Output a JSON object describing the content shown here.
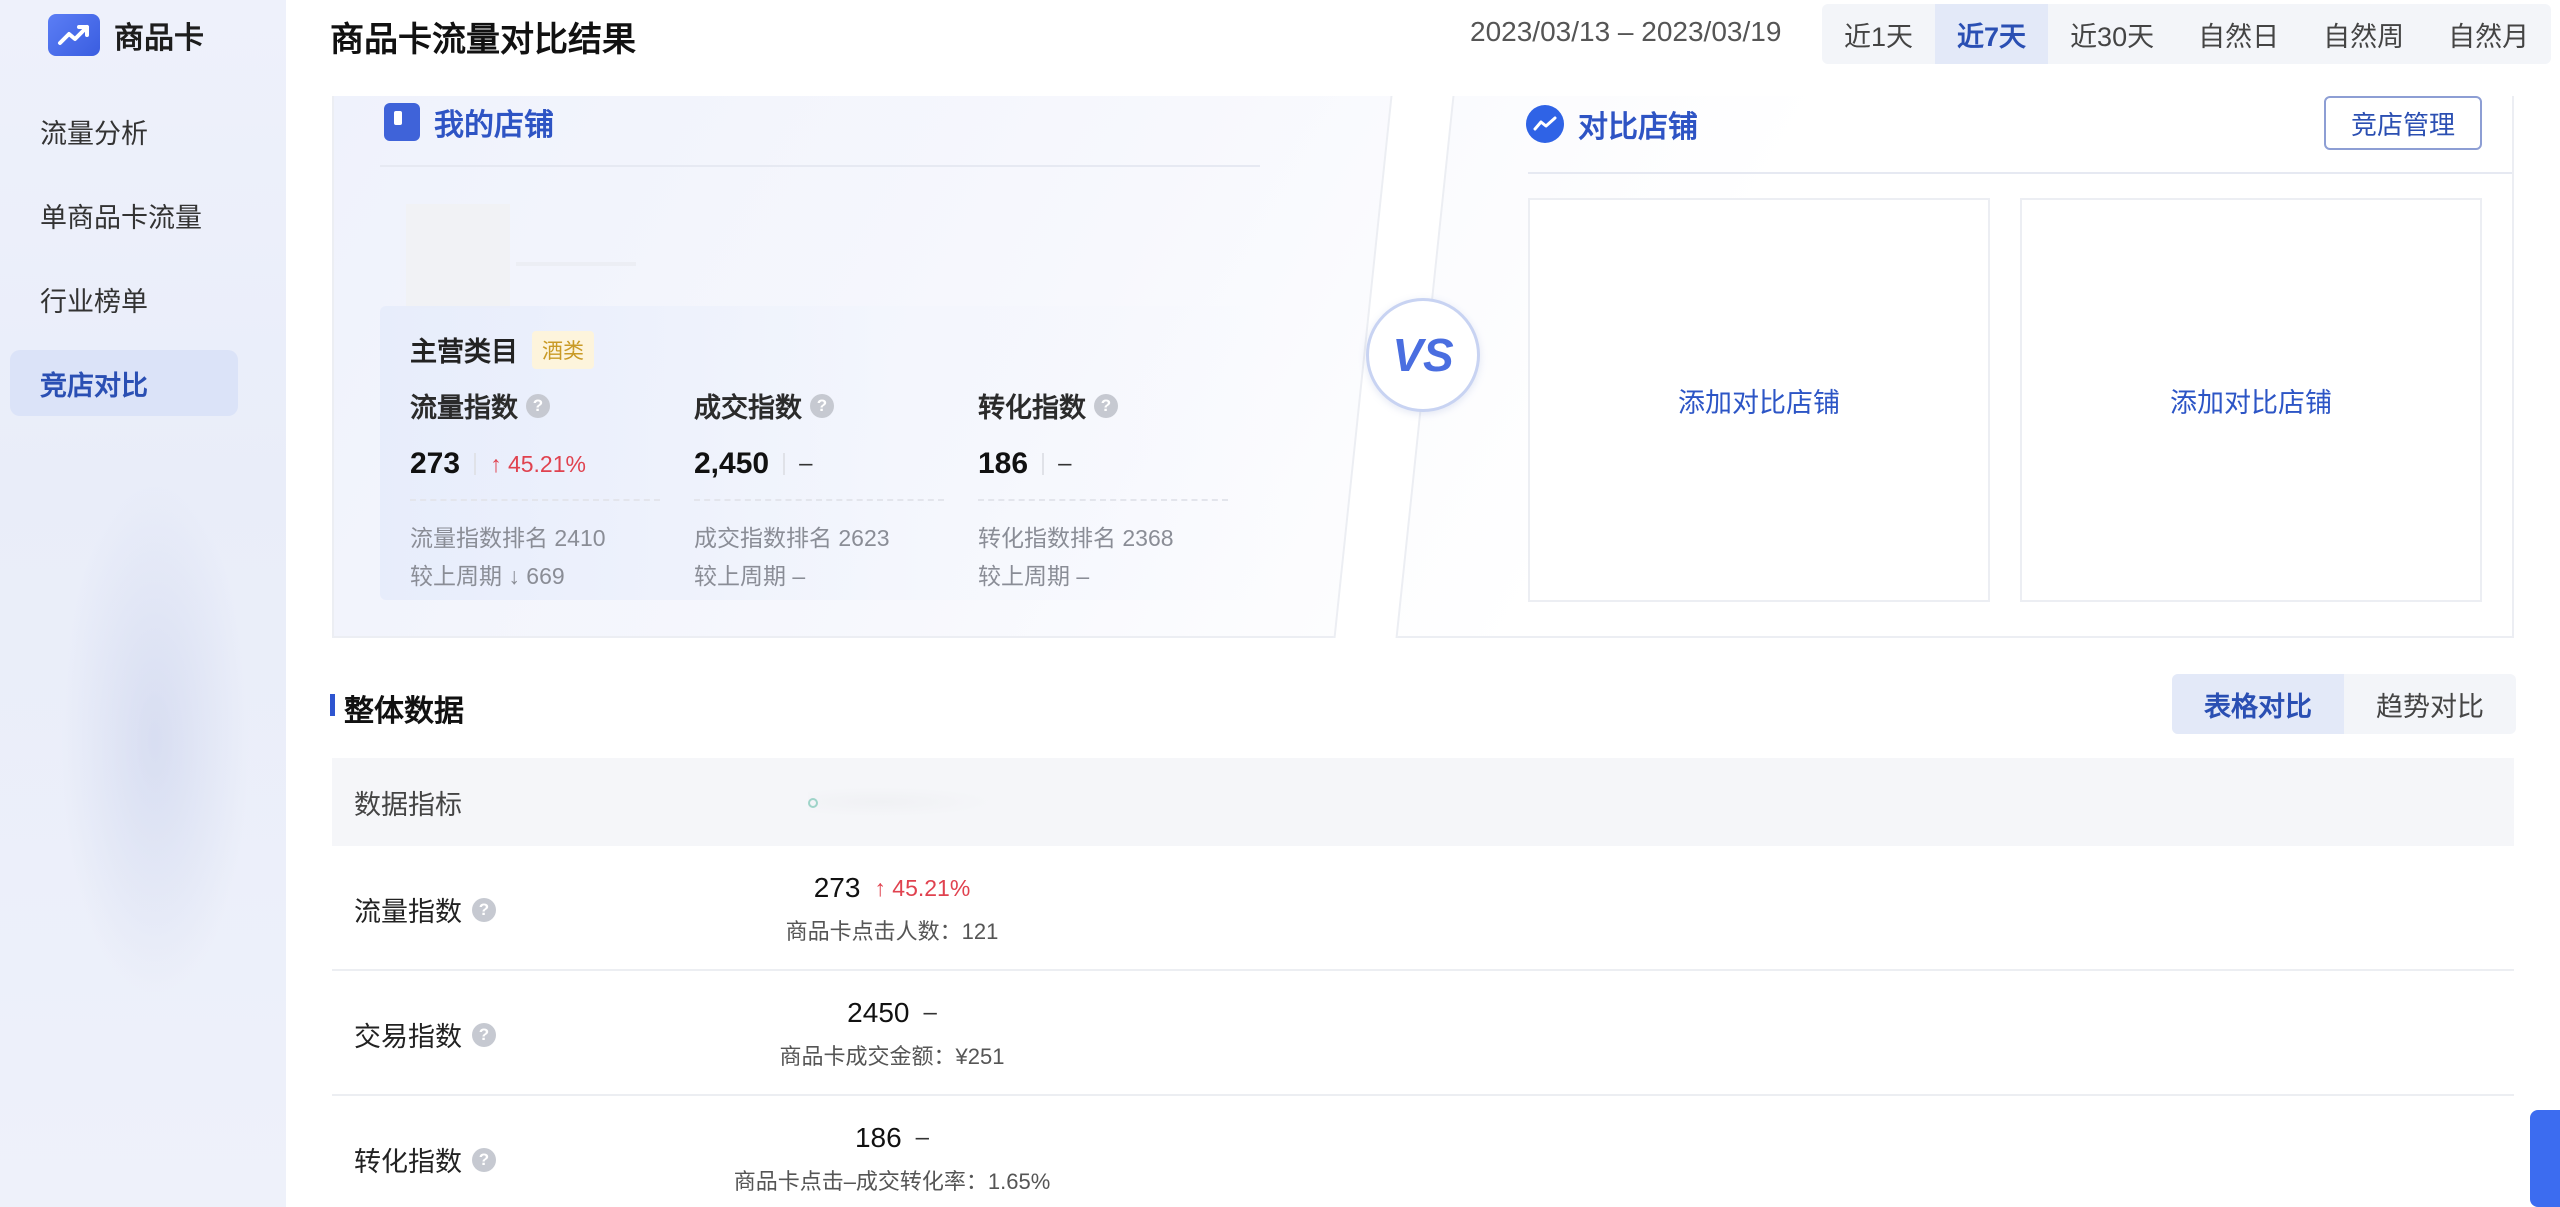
{
  "sidebar": {
    "brand": "商品卡",
    "items": [
      {
        "label": "流量分析"
      },
      {
        "label": "单商品卡流量"
      },
      {
        "label": "行业榜单"
      },
      {
        "label": "竞店对比",
        "active": true
      }
    ]
  },
  "header": {
    "title": "商品卡流量对比结果",
    "date_range": "2023/03/13 – 2023/03/19",
    "range_tabs": [
      "近1天",
      "近7天",
      "近30天",
      "自然日",
      "自然周",
      "自然月"
    ],
    "active_range": "近7天"
  },
  "my_shop": {
    "title": "我的店铺",
    "category_label": "主营类目",
    "category_tag": "酒类",
    "metrics": [
      {
        "name": "流量指数",
        "value": "273",
        "delta": "↑ 45.21%",
        "rank_label": "流量指数排名 2410",
        "period": "较上周期 ↓ 669"
      },
      {
        "name": "成交指数",
        "value": "2,450",
        "delta": "–",
        "rank_label": "成交指数排名 2623",
        "period": "较上周期 –"
      },
      {
        "name": "转化指数",
        "value": "186",
        "delta": "–",
        "rank_label": "转化指数排名 2368",
        "period": "较上周期 –"
      }
    ]
  },
  "vs_label": "VS",
  "compare": {
    "title": "对比店铺",
    "manage_button": "竞店管理",
    "add_slots": [
      "添加对比店铺",
      "添加对比店铺"
    ]
  },
  "overall": {
    "title": "整体数据",
    "view_tabs": [
      "表格对比",
      "趋势对比"
    ],
    "active_view": "表格对比",
    "header_col": "数据指标",
    "rows": [
      {
        "label": "流量指数",
        "value": "273",
        "delta": "↑ 45.21%",
        "sub": "商品卡点击人数：121"
      },
      {
        "label": "交易指数",
        "value": "2450",
        "delta": "–",
        "sub": "商品卡成交金额：¥251"
      },
      {
        "label": "转化指数",
        "value": "186",
        "delta": "–",
        "sub": "商品卡点击–成交转化率：1.65%"
      }
    ]
  },
  "colors": {
    "accent": "#2e54c4",
    "up": "#e0424f",
    "tag": "#c99a26"
  }
}
